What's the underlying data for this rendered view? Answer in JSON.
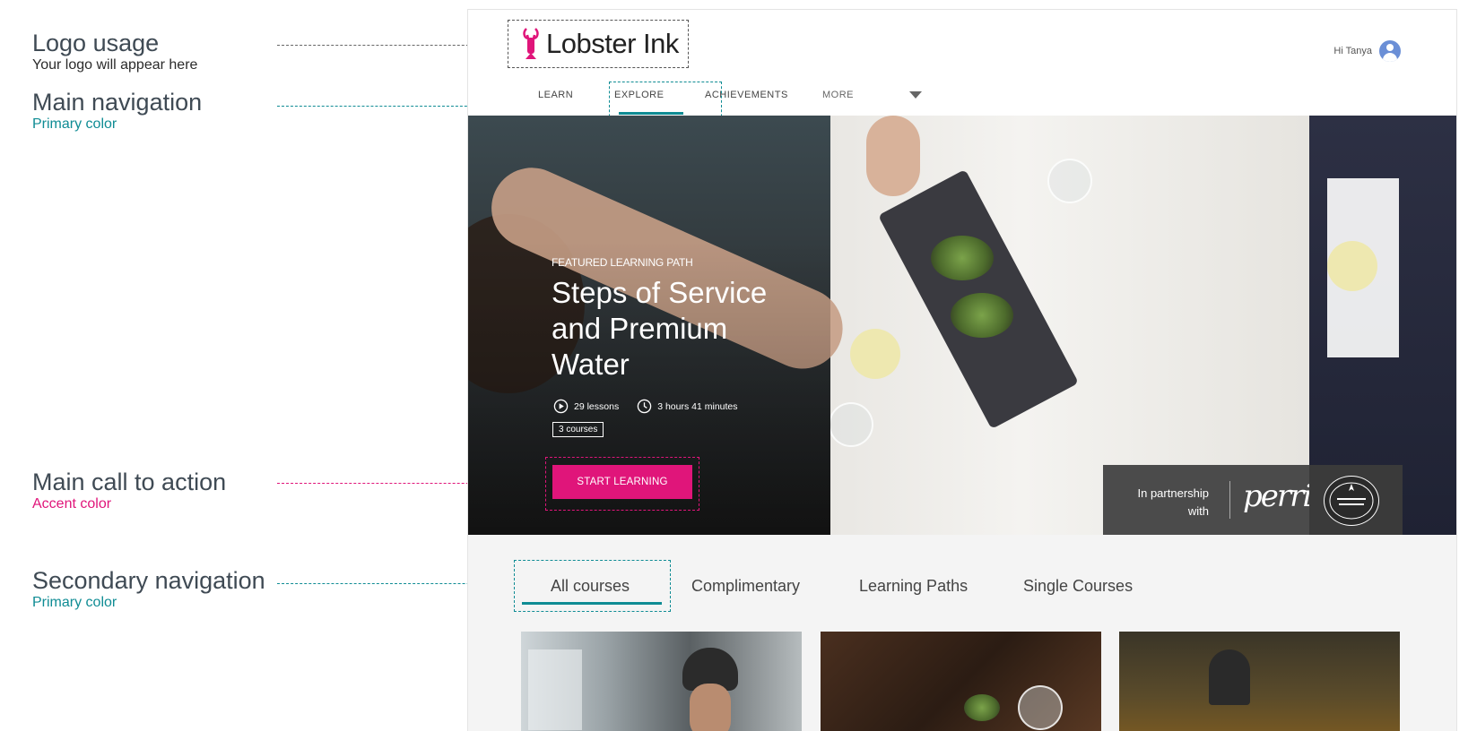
{
  "annotations": [
    {
      "title": "Logo usage",
      "subtitle": "Your logo will appear here"
    },
    {
      "title": "Main navigation",
      "subtitle": "Primary color"
    },
    {
      "title": "Main call to action",
      "subtitle": "Accent color"
    },
    {
      "title": "Secondary navigation",
      "subtitle": "Primary color"
    }
  ],
  "colors": {
    "primary": "#0f8c94",
    "accent": "#e0157a"
  },
  "header": {
    "logo_text": "Lobster Ink",
    "logo_icon": "lobster-icon",
    "user_greeting": "Hi Tanya",
    "avatar_icon": "user-avatar-icon"
  },
  "main_nav": {
    "items": [
      "LEARN",
      "EXPLORE",
      "ACHIEVEMENTS",
      "MORE"
    ],
    "active": "EXPLORE"
  },
  "hero": {
    "eyebrow": "FEATURED LEARNING PATH",
    "title": "Steps of Service and Premium Water",
    "lessons": "29 lessons",
    "duration": "3 hours 41 minutes",
    "courses": "3 courses",
    "cta": "START LEARNING",
    "partner_text": "In partnership with",
    "partner_brand": "perrier"
  },
  "secondary_nav": {
    "items": [
      "All courses",
      "Complimentary",
      "Learning Paths",
      "Single Courses"
    ],
    "active": "All courses"
  }
}
